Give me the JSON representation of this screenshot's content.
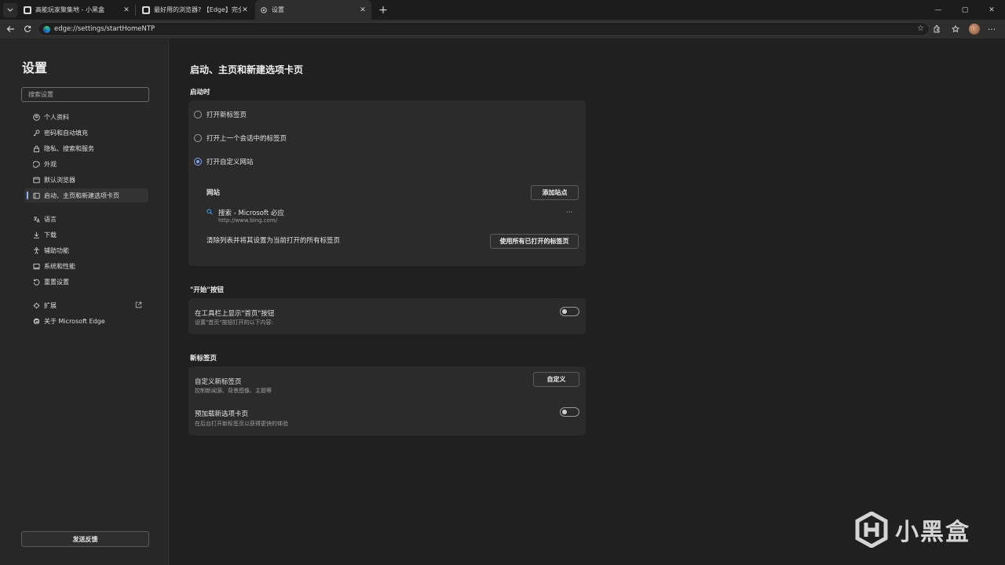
{
  "tabs": [
    {
      "title": "高能玩家聚集地 - 小黑盒",
      "active": false
    },
    {
      "title": "最好用的浏览器? 【Edge】完全指南",
      "active": false
    },
    {
      "title": "设置",
      "active": true
    }
  ],
  "window_controls": {
    "minimize": "—",
    "maximize": "▢",
    "close": "✕"
  },
  "address_bar": {
    "url": "edge://settings/startHomeNTP"
  },
  "sidebar": {
    "title": "设置",
    "search_placeholder": "搜索设置",
    "items": [
      {
        "label": "个人资料",
        "icon": "profile-icon"
      },
      {
        "label": "密码和自动填充",
        "icon": "key-icon"
      },
      {
        "label": "隐私、搜索和服务",
        "icon": "lock-icon"
      },
      {
        "label": "外观",
        "icon": "palette-icon"
      },
      {
        "label": "默认浏览器",
        "icon": "browser-icon"
      },
      {
        "label": "启动、主页和新建选项卡页",
        "icon": "home-page-icon"
      },
      {
        "label": "语言",
        "icon": "language-icon"
      },
      {
        "label": "下载",
        "icon": "download-icon"
      },
      {
        "label": "辅助功能",
        "icon": "accessibility-icon"
      },
      {
        "label": "系统和性能",
        "icon": "computer-icon"
      },
      {
        "label": "重置设置",
        "icon": "reset-icon"
      },
      {
        "label": "扩展",
        "icon": "extension-icon"
      },
      {
        "label": "关于 Microsoft Edge",
        "icon": "edge-logo-icon"
      }
    ],
    "feedback_label": "发送反馈"
  },
  "main": {
    "title": "启动、主页和新建选项卡页",
    "startup": {
      "label": "启动时",
      "options": [
        "打开新标签页",
        "打开上一个会话中的标签页",
        "打开自定义网站"
      ],
      "selected_index": 2,
      "sites_label": "网站",
      "add_site_label": "添加站点",
      "site": {
        "name": "搜索 - Microsoft 必应",
        "url": "http://www.bing.com/",
        "more": "···"
      },
      "clear_text": "清除列表并将其设置为当前打开的所有标签页",
      "use_all_tabs_label": "使用所有已打开的标签页"
    },
    "home_button": {
      "label": "\"开始\"按钮",
      "show_title": "在工具栏上显示\"首页\"按钮",
      "show_desc": "设置\"首页\"按钮打开的以下内容:",
      "enabled": false
    },
    "new_tab": {
      "label": "新标签页",
      "customize_title": "自定义新标签页",
      "customize_desc": "控制新闻源、背景图像、主题等",
      "customize_button": "自定义",
      "preload_title": "预加载新选项卡页",
      "preload_desc": "在后台打开新标签页以获得更快的体验",
      "preload_enabled": false
    }
  },
  "watermark": {
    "text": "小黑盒"
  }
}
